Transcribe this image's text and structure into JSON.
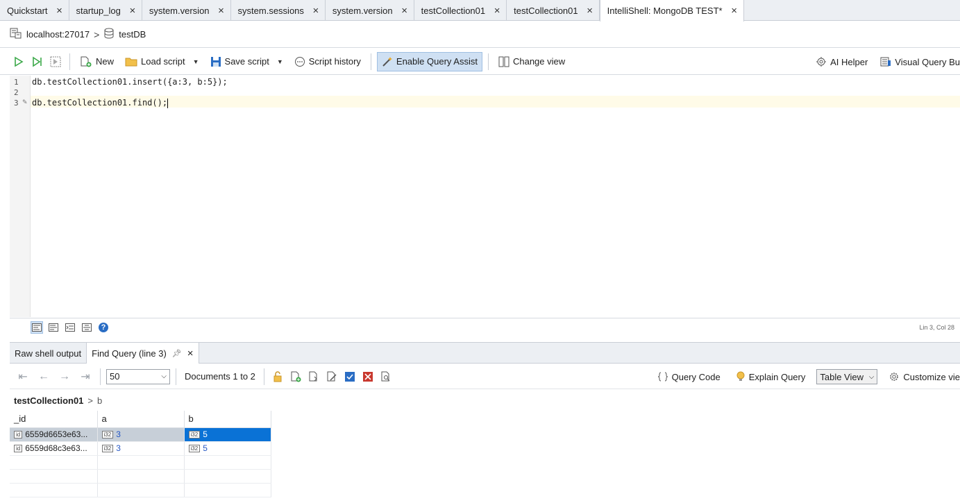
{
  "tabs": [
    {
      "label": "Quickstart"
    },
    {
      "label": "startup_log"
    },
    {
      "label": "system.version"
    },
    {
      "label": "system.sessions"
    },
    {
      "label": "system.version"
    },
    {
      "label": "testCollection01"
    },
    {
      "label": "testCollection01"
    },
    {
      "label": "IntelliShell: MongoDB TEST*"
    }
  ],
  "close_glyph": "×",
  "breadcrumb": {
    "server": "localhost:27017",
    "separator": ">",
    "database": "testDB"
  },
  "toolbar": {
    "new": "New",
    "load": "Load script",
    "save": "Save script",
    "history": "Script history",
    "query_assist": "Enable Query Assist",
    "change_view": "Change view",
    "ai_helper": "AI Helper",
    "visual_query": "Visual Query Bu"
  },
  "editor": {
    "lines": [
      {
        "no": "1",
        "text": "db.testCollection01.insert({a:3, b:5});"
      },
      {
        "no": "2",
        "text": ""
      },
      {
        "no": "3",
        "text": "db.testCollection01.find();"
      }
    ],
    "status": "Lin 3, Col 28",
    "help_glyph": "?"
  },
  "result_tabs": [
    {
      "label": "Raw shell output"
    },
    {
      "label": "Find Query (line 3)"
    }
  ],
  "results_toolbar": {
    "page_size": "50",
    "documents": "Documents 1 to 2",
    "query_code": "Query Code",
    "explain": "Explain Query",
    "view": "Table View",
    "customize": "Customize vie"
  },
  "result_path": {
    "collection": "testCollection01",
    "separator": ">",
    "field": "b"
  },
  "table": {
    "columns": [
      "_id",
      "a",
      "b"
    ],
    "rows": [
      {
        "id": "6559d6653e63...",
        "a": "3",
        "b": "5"
      },
      {
        "id": "6559d68c3e63...",
        "a": "3",
        "b": "5"
      }
    ],
    "type_badges": {
      "id": "id",
      "num": "i32"
    }
  },
  "colors": {
    "accent": "#0a72d6",
    "selected_row": "#c7cfd8",
    "number": "#2456c4",
    "run_green": "#3aa848"
  }
}
